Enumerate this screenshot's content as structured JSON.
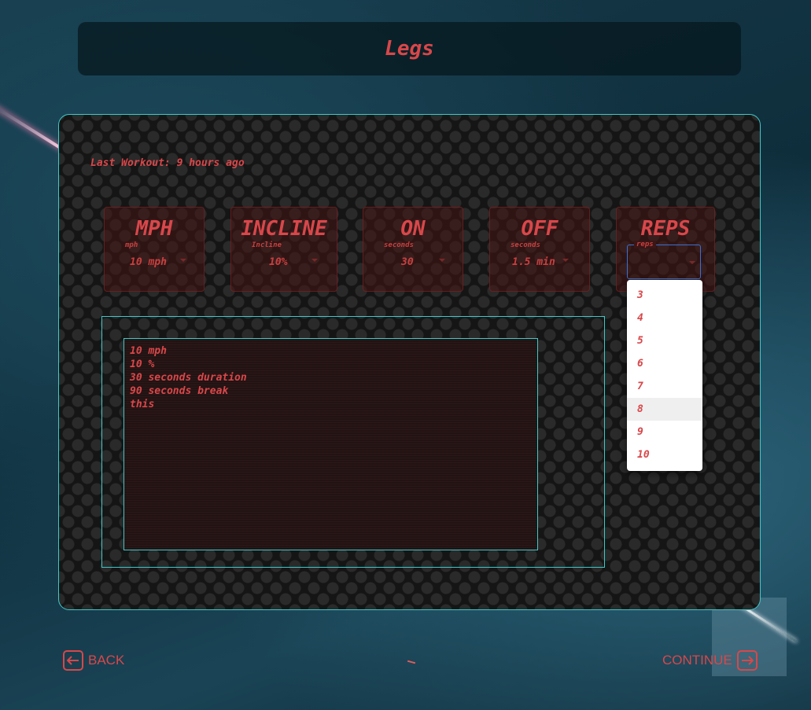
{
  "header": {
    "title": "Legs"
  },
  "last_workout": "Last Workout: 9 hours ago",
  "cards": [
    {
      "title": "MPH",
      "sub": "mph",
      "value": "10 mph"
    },
    {
      "title": "INCLINE",
      "sub": "Incline",
      "value": "10%"
    },
    {
      "title": "ON",
      "sub": "seconds",
      "value": "30"
    },
    {
      "title": "OFF",
      "sub": "seconds",
      "value": "1.5 min"
    },
    {
      "title": "REPS",
      "sub": "reps",
      "value": ""
    }
  ],
  "notes": {
    "lines": [
      "10 mph",
      "10 %",
      "30 seconds duration",
      "90 seconds break",
      "this"
    ]
  },
  "reps_dropdown": {
    "options": [
      "3",
      "4",
      "5",
      "6",
      "7",
      "8",
      "9",
      "10"
    ],
    "highlighted": "8"
  },
  "nav": {
    "back_label": "BACK",
    "continue_label": "CONTINUE"
  },
  "colors": {
    "accent": "#d9474a",
    "border": "#3ec9c9",
    "focus": "#3a6fd0"
  }
}
